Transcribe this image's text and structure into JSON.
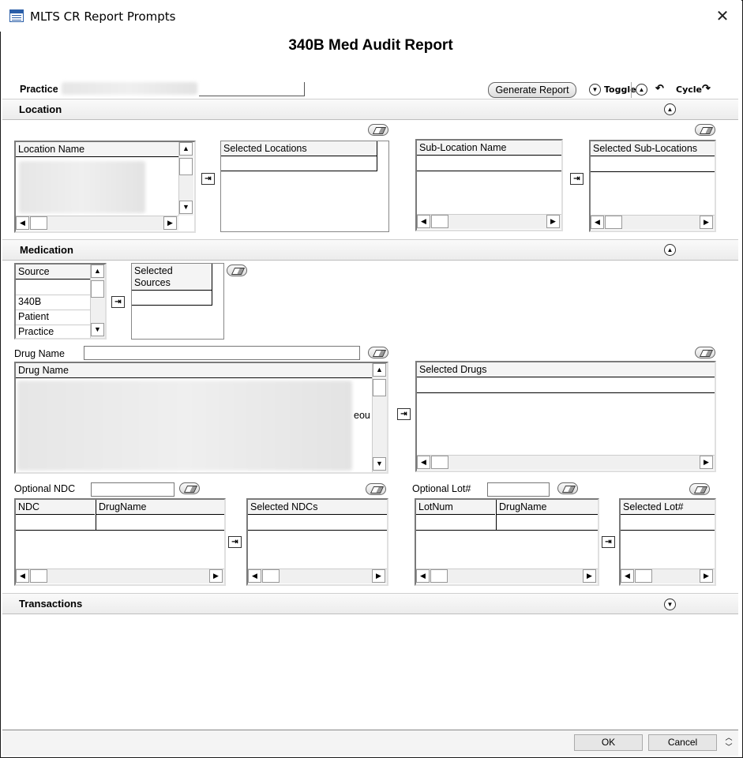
{
  "window": {
    "title": "MLTS CR Report Prompts",
    "close_icon": "close-icon"
  },
  "report": {
    "title": "340B Med Audit Report"
  },
  "toolbar": {
    "practice_label": "Practice",
    "generate": "Generate Report",
    "toggle": "Toggle",
    "cycle": "Cycle"
  },
  "sections": {
    "location": "Location",
    "medication": "Medication",
    "transactions": "Transactions"
  },
  "location": {
    "name_header": "Location Name",
    "selected_header": "Selected Locations",
    "sub_header": "Sub-Location Name",
    "selected_sub_header": "Selected Sub-Locations"
  },
  "source": {
    "header": "Source",
    "items": [
      "340B",
      "Patient",
      "Practice"
    ],
    "selected_header": "Selected Sources"
  },
  "drug": {
    "label": "Drug Name",
    "header": "Drug Name",
    "partial_text": "eou",
    "selected_header": "Selected Drugs"
  },
  "ndc": {
    "label": "Optional NDC",
    "col1": "NDC",
    "col2": "DrugName",
    "selected_header": "Selected NDCs"
  },
  "lot": {
    "label": "Optional Lot#",
    "col1": "LotNum",
    "col2": "DrugName",
    "selected_header": "Selected Lot#"
  },
  "footer": {
    "ok": "OK",
    "cancel": "Cancel"
  }
}
